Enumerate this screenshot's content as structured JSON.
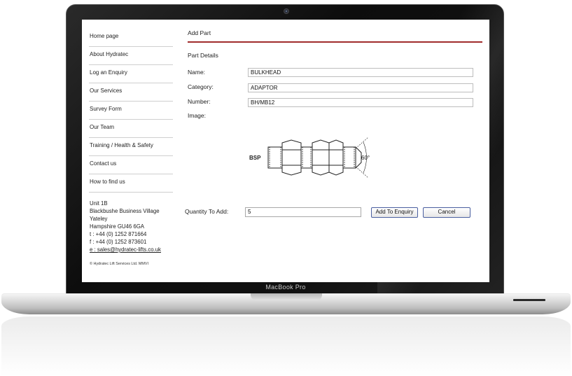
{
  "device": {
    "model_label": "MacBook Pro"
  },
  "sidebar": {
    "items": [
      {
        "label": "Home page"
      },
      {
        "label": "About Hydratec"
      },
      {
        "label": "Log an Enquiry"
      },
      {
        "label": "Our Services"
      },
      {
        "label": "Survey Form"
      },
      {
        "label": "Our Team"
      },
      {
        "label": "Training / Health & Safety"
      },
      {
        "label": "Contact us"
      },
      {
        "label": "How to find us"
      }
    ],
    "address": {
      "line1": "Unit 1B",
      "line2": "Blackbushe Business Village",
      "line3": "Yateley",
      "line4": "Hampshire GU46 6GA",
      "phone": "t : +44 (0) 1252 871664",
      "fax": "f : +44 (0) 1252 873601",
      "email": "e : sales@hydratec-lifts.co.uk"
    },
    "copyright": "© Hydratec Lift Services Ltd. MMVI"
  },
  "main": {
    "title": "Add Part",
    "section": "Part Details",
    "fields": {
      "name": {
        "label": "Name:",
        "value": "BULKHEAD"
      },
      "category": {
        "label": "Category:",
        "value": "ADAPTOR"
      },
      "number": {
        "label": "Number:",
        "value": "BH/MB12"
      }
    },
    "image_label": "Image:",
    "image": {
      "bsp_label": "BSP",
      "angle_label": "60°"
    },
    "quantity": {
      "label": "Quantity To Add:",
      "value": "5"
    },
    "buttons": {
      "add": "Add To Enquiry",
      "cancel": "Cancel"
    }
  },
  "colors": {
    "accent_rule": "#a02c2c",
    "button_border": "#4a5fa0"
  }
}
